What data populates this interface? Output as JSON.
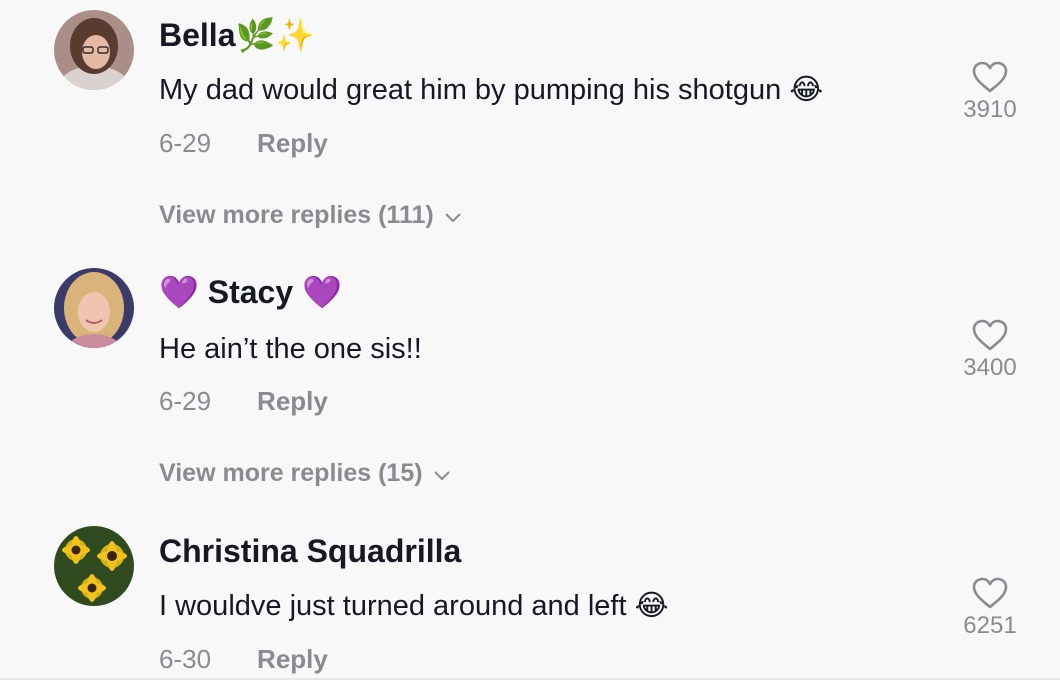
{
  "comments": [
    {
      "username": "Bella",
      "username_suffix": "🌿✨",
      "text": "My dad would great him by pumping his shotgun",
      "text_emoji": "😂",
      "date": "6-29",
      "reply_label": "Reply",
      "likes": "3910",
      "view_more": "View more replies (111)",
      "avatar_icon": "user-photo"
    },
    {
      "username_prefix": "💜",
      "username": "Stacy",
      "username_suffix": "💜",
      "text": "He ain’t the one sis!!",
      "date": "6-29",
      "reply_label": "Reply",
      "likes": "3400",
      "view_more": "View more replies (15)",
      "avatar_icon": "user-photo"
    },
    {
      "username": "Christina Squadrilla",
      "text": "I wouldve just turned around and left",
      "text_emoji": "😂",
      "date": "6-30",
      "reply_label": "Reply",
      "likes": "6251",
      "avatar_icon": "sunflower-photo"
    }
  ],
  "icons": {
    "like": "heart-outline-icon",
    "expand": "chevron-down-icon"
  },
  "colors": {
    "background": "#f8f8f8",
    "primary_text": "#161823",
    "secondary_text": "#8a8b91"
  }
}
